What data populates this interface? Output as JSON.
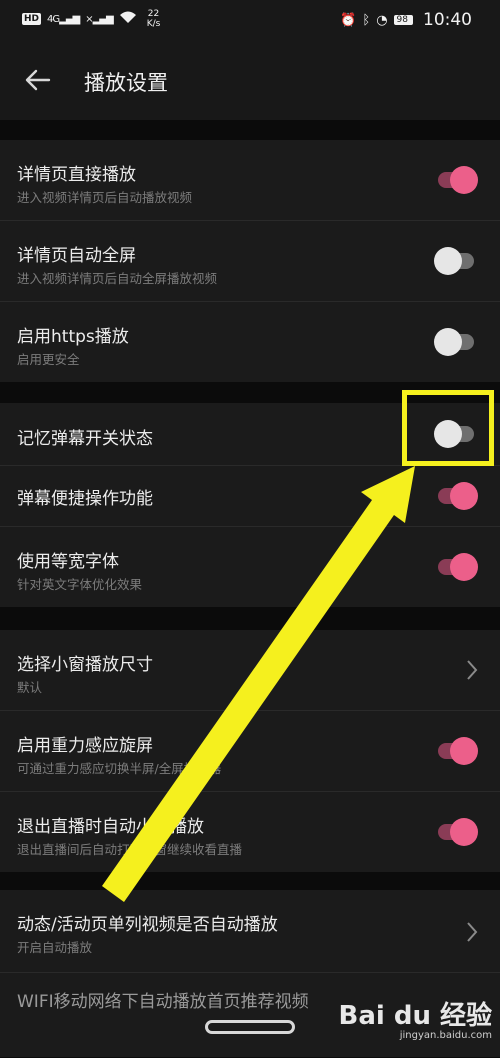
{
  "status_bar": {
    "left": {
      "hd": "HD",
      "signal_1": "4G",
      "signal_2": "×",
      "speed_value": "22",
      "speed_unit": "K/s"
    },
    "battery": "98",
    "time": "10:40"
  },
  "header": {
    "back_icon": "arrow-left-icon",
    "title": "播放设置"
  },
  "groups": [
    {
      "rows": [
        {
          "title": "详情页直接播放",
          "subtitle": "进入视频详情页后自动播放视频",
          "toggle": "on"
        },
        {
          "title": "详情页自动全屏",
          "subtitle": "进入视频详情页后自动全屏播放视频",
          "toggle": "off"
        },
        {
          "title": "启用https播放",
          "subtitle": "启用更安全",
          "toggle": "off"
        }
      ]
    },
    {
      "rows": [
        {
          "title": "记忆弹幕开关状态",
          "toggle": "off"
        },
        {
          "title": "弹幕便捷操作功能",
          "toggle": "on"
        },
        {
          "title": "使用等宽字体",
          "subtitle": "针对英文字体优化效果",
          "toggle": "on"
        }
      ]
    },
    {
      "rows": [
        {
          "title": "选择小窗播放尺寸",
          "subtitle": "默认",
          "control": "chevron-right-icon"
        },
        {
          "title": "启用重力感应旋屏",
          "subtitle": "可通过重力感应切换半屏/全屏播放器",
          "toggle": "on"
        },
        {
          "title": "退出直播时自动小窗播放",
          "subtitle": "退出直播间后自动打开小窗继续收看直播",
          "toggle": "on"
        }
      ]
    },
    {
      "rows": [
        {
          "title": "动态/活动页单列视频是否自动播放",
          "subtitle": "开启自动播放",
          "control": "chevron-right-icon"
        },
        {
          "title": "WIFI移动网络下自动播放首页推荐视频"
        }
      ]
    }
  ],
  "watermark": {
    "logo": "Bai du 经验",
    "url": "jingyan.baidu.com"
  },
  "colors": {
    "background": "#0b0b0b",
    "card": "#1b1b1b",
    "accent_pink": "#ec5f8a",
    "annotation_yellow": "#f5f01e"
  }
}
